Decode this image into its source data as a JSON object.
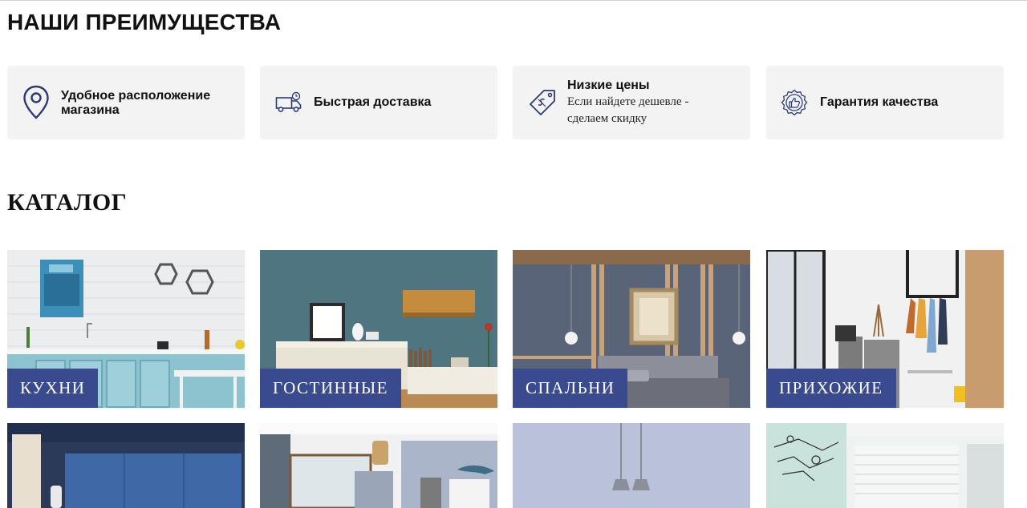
{
  "advantages": {
    "heading": "НАШИ ПРЕИМУЩЕСТВА",
    "items": [
      {
        "icon": "map-pin-icon",
        "title": "Удобное расположение магазина",
        "title_line1": "Удобное расположение",
        "title_line2": "магазина"
      },
      {
        "icon": "delivery-truck-icon",
        "title": "Быстрая доставка"
      },
      {
        "icon": "price-tag-icon",
        "title": "Низкие цены",
        "subtitle_line1": "Если найдете дешевле -",
        "subtitle_line2": "сделаем скидку"
      },
      {
        "icon": "quality-badge-icon",
        "title": "Гарантия качества"
      }
    ]
  },
  "catalog": {
    "heading": "КАТАЛОГ",
    "categories": [
      {
        "label": "КУХНИ",
        "image": "kitchen-photo"
      },
      {
        "label": "ГОСТИННЫЕ",
        "image": "living-room-photo"
      },
      {
        "label": "СПАЛЬНИ",
        "image": "bedroom-photo"
      },
      {
        "label": "ПРИХОЖИЕ",
        "image": "hallway-photo"
      }
    ],
    "second_row_images": [
      "wardrobe-photo",
      "kids-room-photo",
      "pendant-lamps-photo",
      "office-photo"
    ]
  },
  "colors": {
    "accent": "#3a4a8e",
    "card_bg": "#f3f3f3",
    "icon": "#2c3a7a"
  }
}
